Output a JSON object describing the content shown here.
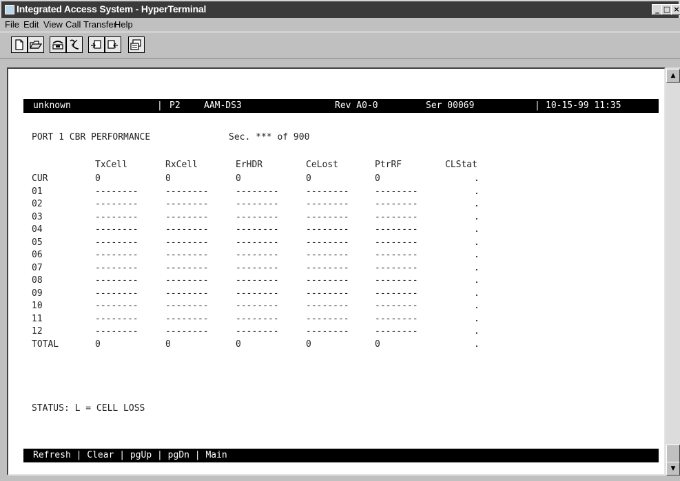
{
  "window": {
    "title": "Integrated Access System - HyperTerminal",
    "min_glyph": "_",
    "max_glyph": "□",
    "close_glyph": "×"
  },
  "menu": {
    "file": "File",
    "edit": "Edit",
    "view": "View",
    "call": "Call",
    "transfer": "Transfer",
    "help": "Help"
  },
  "scrollbar": {
    "up_glyph": "▲",
    "down_glyph": "▼"
  },
  "terminal": {
    "header": {
      "node": "unknown",
      "sep": "|",
      "slot": "P2",
      "card": "AAM-DS3",
      "rev": "Rev A0-0",
      "ser": "Ser 00069",
      "datetime": "10-15-99 11:35"
    },
    "screen_title": "PORT 1 CBR PERFORMANCE",
    "sec_label": "Sec. *** of 900",
    "columns": [
      "TxCell",
      "RxCell",
      "ErHDR",
      "CeLost",
      "PtrRF",
      "CLStat"
    ],
    "rows": [
      {
        "label": "CUR",
        "values": [
          "0",
          "0",
          "0",
          "0",
          "0",
          "."
        ]
      },
      {
        "label": "01",
        "values": [
          "--------",
          "--------",
          "--------",
          "--------",
          "--------",
          "."
        ]
      },
      {
        "label": "02",
        "values": [
          "--------",
          "--------",
          "--------",
          "--------",
          "--------",
          "."
        ]
      },
      {
        "label": "03",
        "values": [
          "--------",
          "--------",
          "--------",
          "--------",
          "--------",
          "."
        ]
      },
      {
        "label": "04",
        "values": [
          "--------",
          "--------",
          "--------",
          "--------",
          "--------",
          "."
        ]
      },
      {
        "label": "05",
        "values": [
          "--------",
          "--------",
          "--------",
          "--------",
          "--------",
          "."
        ]
      },
      {
        "label": "06",
        "values": [
          "--------",
          "--------",
          "--------",
          "--------",
          "--------",
          "."
        ]
      },
      {
        "label": "07",
        "values": [
          "--------",
          "--------",
          "--------",
          "--------",
          "--------",
          "."
        ]
      },
      {
        "label": "08",
        "values": [
          "--------",
          "--------",
          "--------",
          "--------",
          "--------",
          "."
        ]
      },
      {
        "label": "09",
        "values": [
          "--------",
          "--------",
          "--------",
          "--------",
          "--------",
          "."
        ]
      },
      {
        "label": "10",
        "values": [
          "--------",
          "--------",
          "--------",
          "--------",
          "--------",
          "."
        ]
      },
      {
        "label": "11",
        "values": [
          "--------",
          "--------",
          "--------",
          "--------",
          "--------",
          "."
        ]
      },
      {
        "label": "12",
        "values": [
          "--------",
          "--------",
          "--------",
          "--------",
          "--------",
          "."
        ]
      },
      {
        "label": "TOTAL",
        "values": [
          "0",
          "0",
          "0",
          "0",
          "0",
          "."
        ]
      }
    ],
    "status_line": "STATUS: L = CELL LOSS",
    "footer": "Refresh | Clear | pgUp | pgDn | Main"
  }
}
